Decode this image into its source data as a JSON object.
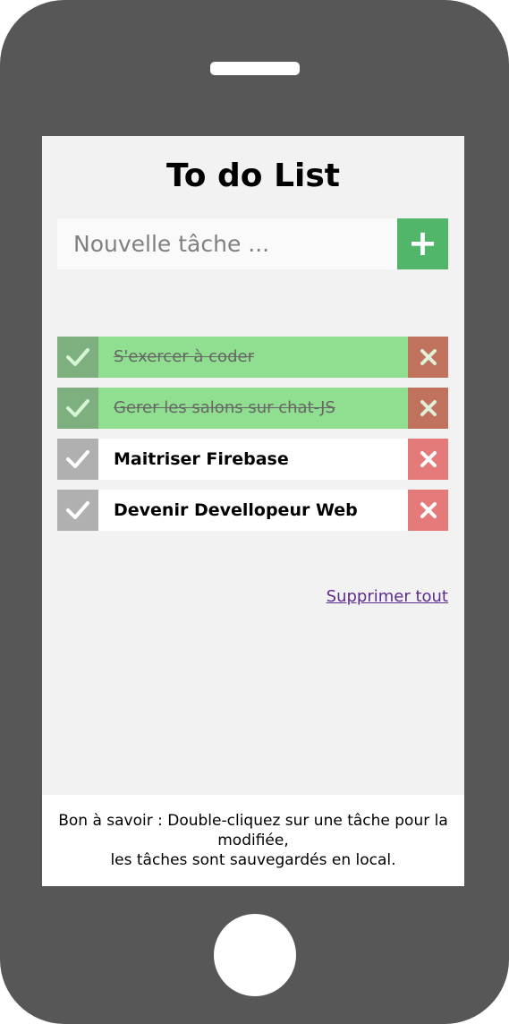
{
  "app": {
    "title": "To do List"
  },
  "form": {
    "placeholder": "Nouvelle tâche ...",
    "add_label": "+"
  },
  "tasks": [
    {
      "label": "S'exercer à coder",
      "done": true
    },
    {
      "label": "Gerer les salons sur chat-JS",
      "done": true
    },
    {
      "label": "Maitriser Firebase",
      "done": false
    },
    {
      "label": "Devenir Devellopeur Web",
      "done": false
    }
  ],
  "actions": {
    "delete_all_label": "Supprimer tout"
  },
  "footer": {
    "line1": "Bon à savoir : Double-cliquez sur une tâche pour la modifiée,",
    "line2": "les tâches sont sauvegardés en local."
  },
  "icons": {
    "check": "check-icon",
    "delete": "close-icon",
    "add": "plus-icon"
  },
  "colors": {
    "phone_body": "#575757",
    "screen_bg": "#f2f2f2",
    "add_button": "#51b56a",
    "done_task": "#90de90",
    "delete_button": "#e57a7a",
    "link": "#5b2d8e"
  }
}
